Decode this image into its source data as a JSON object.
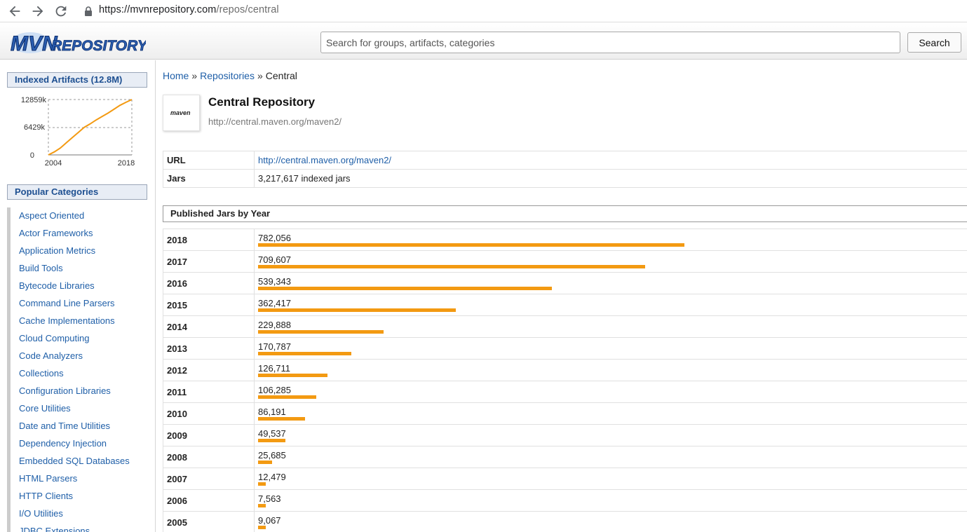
{
  "browser": {
    "url_host": "https://mvnrepository.com",
    "url_path": "/repos/central"
  },
  "header": {
    "logo_text": "MVNREPOSITORY",
    "search_placeholder": "Search for groups, artifacts, categories",
    "search_button": "Search"
  },
  "sidebar": {
    "indexed_title": "Indexed Artifacts (12.8M)",
    "chart_data": {
      "type": "line",
      "title": "",
      "x": [
        2004,
        2005,
        2006,
        2007,
        2008,
        2009,
        2010,
        2011,
        2012,
        2013,
        2014,
        2015,
        2016,
        2017,
        2018
      ],
      "values": [
        0,
        700,
        1600,
        2800,
        4000,
        5200,
        6400,
        7200,
        8100,
        8900,
        9700,
        10600,
        11500,
        12200,
        12859
      ],
      "ytick_labels": [
        "12859k",
        "6429k",
        "0"
      ],
      "xtick_labels": [
        "2004",
        "2018"
      ],
      "ylim": [
        0,
        12859
      ],
      "colors": {
        "line": "#f39a12",
        "grid": "#999999"
      }
    },
    "categories_title": "Popular Categories",
    "categories": [
      "Aspect Oriented",
      "Actor Frameworks",
      "Application Metrics",
      "Build Tools",
      "Bytecode Libraries",
      "Command Line Parsers",
      "Cache Implementations",
      "Cloud Computing",
      "Code Analyzers",
      "Collections",
      "Configuration Libraries",
      "Core Utilities",
      "Date and Time Utilities",
      "Dependency Injection",
      "Embedded SQL Databases",
      "HTML Parsers",
      "HTTP Clients",
      "I/O Utilities",
      "JDBC Extensions"
    ]
  },
  "main": {
    "breadcrumb": {
      "home": "Home",
      "sep1": "»",
      "repositories": "Repositories",
      "sep2": "»",
      "current": "Central"
    },
    "repo_logo_text": "maven",
    "title": "Central Repository",
    "url_text": "http://central.maven.org/maven2/",
    "info": [
      {
        "key": "URL",
        "value": "http://central.maven.org/maven2/",
        "link": true
      },
      {
        "key": "Jars",
        "value": "3,217,617 indexed jars",
        "link": false
      }
    ],
    "section_title": "Published Jars by Year",
    "bar_color": "#f39a12",
    "bar_max": 782056,
    "years": [
      {
        "year": "2018",
        "count": "782,056",
        "value": 782056
      },
      {
        "year": "2017",
        "count": "709,607",
        "value": 709607
      },
      {
        "year": "2016",
        "count": "539,343",
        "value": 539343
      },
      {
        "year": "2015",
        "count": "362,417",
        "value": 362417
      },
      {
        "year": "2014",
        "count": "229,888",
        "value": 229888
      },
      {
        "year": "2013",
        "count": "170,787",
        "value": 170787
      },
      {
        "year": "2012",
        "count": "126,711",
        "value": 126711
      },
      {
        "year": "2011",
        "count": "106,285",
        "value": 106285
      },
      {
        "year": "2010",
        "count": "86,191",
        "value": 86191
      },
      {
        "year": "2009",
        "count": "49,537",
        "value": 49537
      },
      {
        "year": "2008",
        "count": "25,685",
        "value": 25685
      },
      {
        "year": "2007",
        "count": "12,479",
        "value": 12479
      },
      {
        "year": "2006",
        "count": "7,563",
        "value": 7563
      },
      {
        "year": "2005",
        "count": "9,067",
        "value": 9067
      }
    ]
  }
}
